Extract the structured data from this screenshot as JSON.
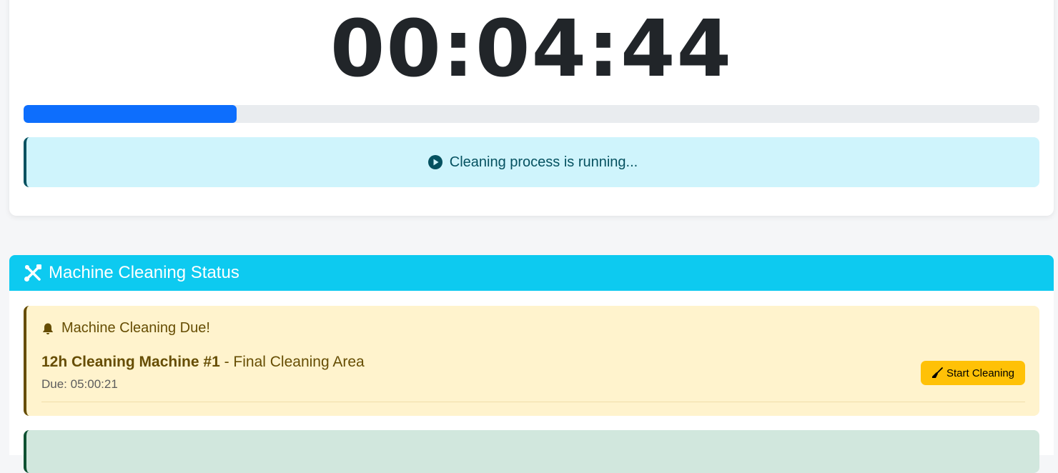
{
  "timer": {
    "display": "00:04:44",
    "progress_fraction": 0.21
  },
  "alert": {
    "text": "Cleaning process is running...",
    "icon": "play-circle-icon"
  },
  "machine_status": {
    "title": "Machine Cleaning Status",
    "icon": "tools-icon",
    "header_color": "#0dcaf0",
    "due_card": {
      "title": "Machine Cleaning Due!",
      "icon": "bell-icon",
      "machine_name": "12h Cleaning Machine #1",
      "area": " - Final Cleaning Area",
      "due_label": "Due: 05:00:21",
      "button_label": "Start Cleaning",
      "button_icon": "broom-icon"
    }
  },
  "colors": {
    "progress": "#0d6efd",
    "alert_bg": "#cff4fc",
    "warning_bg": "#fff3cd",
    "warning_button": "#ffc107",
    "success_bg": "#d1e7dd"
  }
}
